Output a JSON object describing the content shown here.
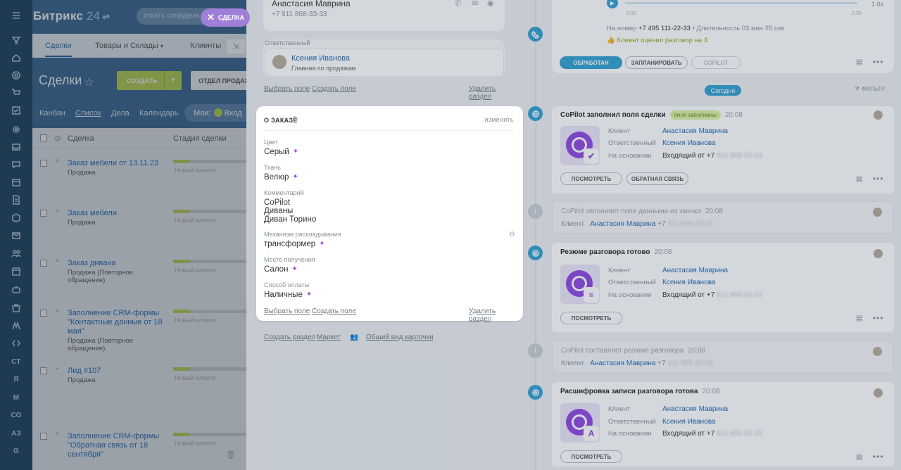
{
  "rail": {
    "items": [
      "menu-icon",
      "filter-icon",
      "home-icon",
      "target-icon",
      "cart-icon",
      "check-icon",
      "gear-icon",
      "inbox-icon",
      "chat-icon",
      "calendar-icon",
      "doc-icon",
      "box-icon",
      "mail-icon",
      "users-icon",
      "store-icon",
      "robot-icon",
      "bag-icon",
      "m-icon",
      "code-icon"
    ],
    "letters": [
      "СТ",
      "Я",
      "М",
      "СО",
      "АЗ",
      "G"
    ]
  },
  "crm": {
    "logo_word": "Битрикс",
    "logo_num": "24",
    "search_placeholder": "искать сотрудник",
    "nav": [
      "Сделки",
      "Товары и Склады",
      "Клиенты"
    ],
    "page_title": "Сделки",
    "create_label": "СОЗДАТЬ",
    "detail_label": "ОТДЕЛ ПРОДАЖ",
    "views": [
      "Канбан",
      "Список",
      "Дела",
      "Календарь"
    ],
    "moi_label": "Мои:",
    "moi_count": "1",
    "moi_tail": "Вход",
    "grid_headers": [
      "Сделка",
      "Стадия сделки"
    ],
    "rows": [
      {
        "title": "Заказ мебели от 13.11.23",
        "sub": "Продажа",
        "stage": "Новый клиент"
      },
      {
        "title": "Заказ мебели",
        "sub": "Продажа",
        "stage": "Новый клиент"
      },
      {
        "title": "Заказ дивана",
        "sub": "Продажа (Повторное обращение)",
        "stage": "Новый клиент"
      },
      {
        "title": "Заполнение CRM-формы \"Контактные данные от 18 мая\"",
        "sub": "Продажа (Повторное обращение)",
        "stage": "Новый клиент"
      },
      {
        "title": "Лид #107",
        "sub": "Продажа",
        "stage": "Новый клиент"
      },
      {
        "title": "Заполнение CRM-формы \"Обратная связь от 18 сентября\"",
        "sub": "",
        "stage": "Новый клиент"
      }
    ]
  },
  "close_label": "СДЕЛКА",
  "left": {
    "contact_name": "Анастасия Маврина",
    "contact_phone": "+7 911 868-33-33",
    "resp_label": "Ответственный",
    "resp_name": "Ксения Иванова",
    "resp_post": "Главная по продажам",
    "link_select": "Выбрать поле",
    "link_create": "Создать поле",
    "link_delete": "Удалить раздел",
    "order": {
      "title": "О ЗАКАЗЕ",
      "change": "изменить",
      "fields": [
        {
          "label": "Цвет",
          "value": "Серый"
        },
        {
          "label": "Ткань",
          "value": "Велюр"
        },
        {
          "label": "Комментарий",
          "value": "CoPilot\nДиваны\nДиван Торино"
        },
        {
          "label": "Механизм раскладывания",
          "value": "трансформер"
        },
        {
          "label": "Место получения",
          "value": "Салон"
        },
        {
          "label": "Способ оплаты",
          "value": "Наличные"
        }
      ]
    },
    "bottom": {
      "create_section": "Создать раздел",
      "market": "Маркет",
      "common_view": "Общий вид карточки"
    }
  },
  "call": {
    "t_start": "0:00",
    "t_end": "2:35",
    "speed": "1.0x",
    "info_prefix": "На номер",
    "info_number": "+7 495 111-22-33",
    "info_duration": "Длительность 03 мин 25 сек",
    "rating": "Клиент оценил разговор на 3",
    "btn_done": "ОБРАБОТАН",
    "btn_plan": "ЗАПЛАНИРОВАТЬ",
    "btn_copilot": "COPILOT"
  },
  "timeline": {
    "today": "Сегодня",
    "filter": "ФИЛЬТР",
    "labels": {
      "client": "Клиент",
      "resp": "Ответственный",
      "basis": "На основании"
    },
    "client_name": "Анастасия Маврина",
    "resp_name": "Ксения Иванова",
    "basis_prefix": "Входящий от +7",
    "phone_masked": "911 868-33-33",
    "phone_prefix": "+7",
    "btn_view": "ПОСМОТРЕТЬ",
    "btn_feedback": "ОБРАТНАЯ СВЯЗЬ",
    "items": [
      {
        "title": "CoPilot заполнил поля сделки",
        "badge": "поля заполнены",
        "time": "20:08"
      },
      {
        "title": "CoPilot заполняет поля данными из звонка",
        "time": "20:08"
      },
      {
        "title": "Резюме разговора готово",
        "time": "20:08"
      },
      {
        "title": "CoPilot составляет резюме разговора",
        "time": "20:08"
      },
      {
        "title": "Расшифровка записи разговора готова",
        "time": "20:08"
      }
    ]
  }
}
